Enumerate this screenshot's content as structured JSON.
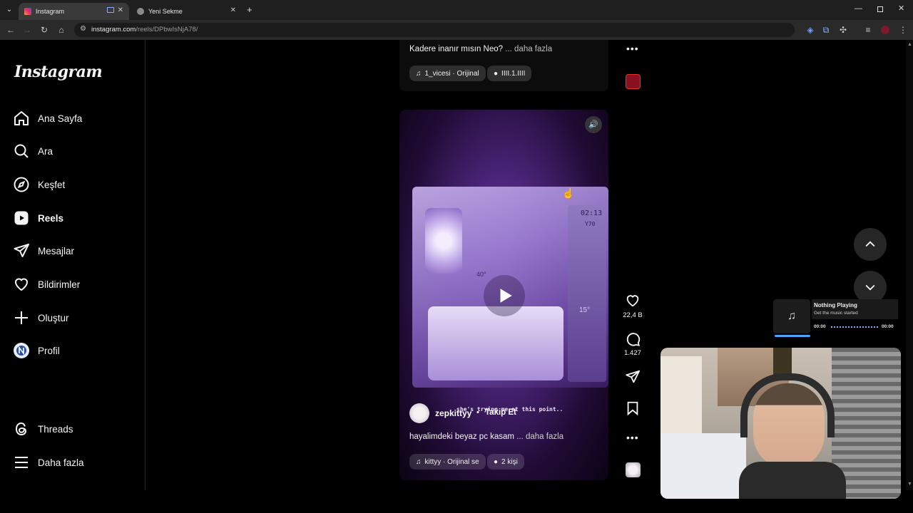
{
  "browser": {
    "tabs": [
      {
        "title": "Instagram",
        "active": true
      },
      {
        "title": "Yeni Sekme",
        "active": false
      }
    ],
    "url_host": "instagram.com",
    "url_path": "/reels/DPbwIsNjA78/"
  },
  "sidebar": {
    "logo": "Instagram",
    "items": [
      {
        "label": "Ana Sayfa",
        "icon": "home-icon"
      },
      {
        "label": "Ara",
        "icon": "search-icon"
      },
      {
        "label": "Keşfet",
        "icon": "compass-icon"
      },
      {
        "label": "Reels",
        "icon": "reels-icon",
        "active": true
      },
      {
        "label": "Mesajlar",
        "icon": "send-icon"
      },
      {
        "label": "Bildirimler",
        "icon": "heart-icon"
      },
      {
        "label": "Oluştur",
        "icon": "plus-icon"
      },
      {
        "label": "Profil",
        "icon": "avatar-icon"
      }
    ],
    "bottom": [
      {
        "label": "Threads",
        "icon": "threads-icon"
      },
      {
        "label": "Daha fazla",
        "icon": "menu-icon"
      }
    ]
  },
  "prev_reel": {
    "caption": "Kadere inanır mısın Neo?",
    "more": "... daha fazla",
    "audio": "1_vicesi · Orijinal",
    "people": "IIII.1.IIII"
  },
  "reel": {
    "overlay_text": "she's trying me at this point..",
    "username": "zepkittyy",
    "dot": "•",
    "follow": "Takip Et",
    "caption": "hayalimdeki beyaz pc kasam",
    "more": "... daha fazla",
    "audio": "kittyy · Orijinal se",
    "people": "2 kişi",
    "case_texts": [
      "02:13",
      "Y70",
      "40°",
      "15°"
    ],
    "likes": "22,4 B",
    "comments": "1.427"
  },
  "music_widget": {
    "title": "Nothing Playing",
    "subtitle": "Get the music started",
    "time_start": "00:00",
    "time_end": "00:00"
  },
  "colors": {
    "accent_instagram": "#e1306c",
    "background": "#000000",
    "reel_purple": "#6d4aa6"
  }
}
